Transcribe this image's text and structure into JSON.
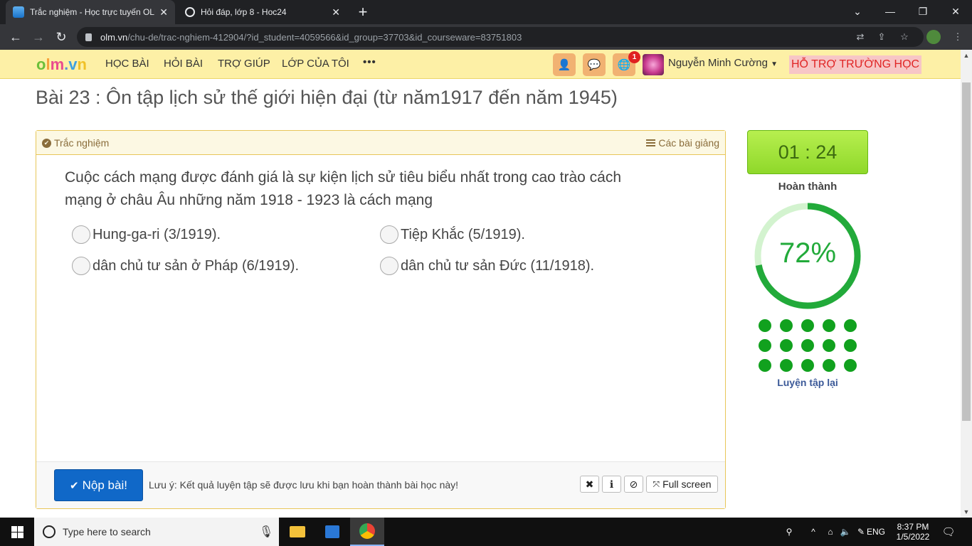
{
  "browser": {
    "tabs": [
      {
        "title": "Trắc nghiệm - Học trực tuyến OLM",
        "close": "✕"
      },
      {
        "title": "Hỏi đáp, lớp 8 - Hoc24",
        "close": "✕"
      }
    ],
    "new_tab": "+",
    "window_controls": {
      "minimize": "—",
      "maximize": "❐",
      "close": "✕",
      "dropdown": "⌄"
    },
    "url_domain": "olm.vn",
    "url_path": "/chu-de/trac-nghiem-412904/?id_student=4059566&id_group=37703&id_courseware=83751803",
    "nav": {
      "back": "←",
      "forward": "→",
      "reload": "↻"
    }
  },
  "site": {
    "logo": {
      "o": "o",
      "l": "l",
      "m": "m",
      "dot": ".",
      "v": "v",
      "n": "n"
    },
    "nav": [
      "HỌC BÀI",
      "HỎI BÀI",
      "TRỢ GIÚP",
      "LỚP CỦA TÔI"
    ],
    "more": "•••",
    "notification_count": "1",
    "username": "Nguyễn Minh Cường",
    "support": "HỖ TRỢ TRƯỜNG HỌC"
  },
  "page_title": "Bài 23 : Ôn tập lịch sử thế giới hiện đại (từ năm1917 đến năm 1945)",
  "quiz": {
    "header_left": "Trắc nghiệm",
    "header_right": "Các bài giảng",
    "question_line1": "Cuộc cách mạng được đánh giá là sự kiện lịch sử tiêu biểu nhất trong cao trào cách",
    "question_line2": "mạng ở châu Âu những năm 1918 - 1923 là cách mạng",
    "options": [
      "Hung-ga-ri (3/1919).",
      "Tiệp Khắc (5/1919).",
      "dân chủ tư sản ở Pháp (6/1919).",
      "dân chủ tư sản Đức (11/1918)."
    ],
    "submit": "Nộp bài!",
    "note": "Lưu ý: Kết quả luyện tập sẽ được lưu khi bạn hoàn thành bài học này!",
    "tools": {
      "close": "✖",
      "info": "ℹ",
      "ban": "⊘",
      "fullscreen": "Full screen"
    }
  },
  "sidebar": {
    "timer": "01 : 24",
    "done_label": "Hoàn thành",
    "progress_percent": 72,
    "progress_text": "72%",
    "dots_count": 15,
    "retry": "Luyện tập lại",
    "colors": {
      "progress": "#22aa3a",
      "track": "#d3f3cf",
      "dot": "#11a11e"
    }
  },
  "taskbar": {
    "search_placeholder": "Type here to search",
    "lang": "ENG",
    "time": "8:37 PM",
    "date": "1/5/2022"
  }
}
